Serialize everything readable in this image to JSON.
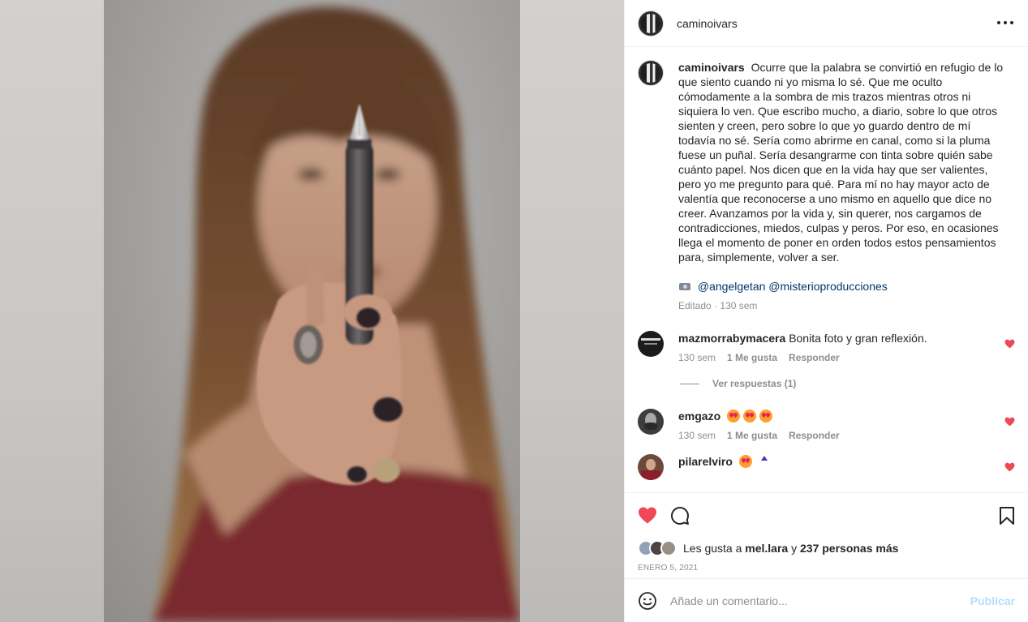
{
  "post": {
    "username": "caminoivars",
    "more_icon": "more-horizontal-icon",
    "caption_text": "Ocurre que la palabra se convirtió en refugio de lo que siento cuando ni yo misma lo sé. Que me oculto cómodamente a la sombra de mis trazos mientras otros ni siquiera lo ven. Que escribo mucho, a diario, sobre lo que otros sienten y creen, pero sobre lo que yo guardo dentro de mí todavía no sé. Sería como abrirme en canal, como si la pluma fuese un puñal. Sería desangrarme con tinta sobre quién sabe cuánto papel. Nos dicen que en la vida hay que ser valientes, pero yo me pregunto para qué. Para mí no hay mayor acto de valentía que reconocerse a uno mismo en aquello que dice no creer. Avanzamos por la vida y, sin querer, nos cargamos de contradicciones, miedos, culpas y peros. Por eso, en ocasiones llega el momento de poner en orden todos estos pensamientos para, simplemente, volver a ser.",
    "credit_icon": "camera-icon",
    "credit_1": "@angelgetan",
    "credit_2": "@misterioproducciones",
    "edited_label": "Editado",
    "edited_separator": "·",
    "edited_age": "130 sem"
  },
  "comments": [
    {
      "username": "mazmorrabymacera",
      "text": "Bonita foto y gran reflexión.",
      "age": "130 sem",
      "likes": "1 Me gusta",
      "reply": "Responder",
      "view_replies": "Ver respuestas (1)"
    },
    {
      "username": "emgazo",
      "text": "",
      "age": "130 sem",
      "likes": "1 Me gusta",
      "reply": "Responder"
    },
    {
      "username": "pilarelviro",
      "text": ""
    }
  ],
  "likes": {
    "prefix": "Les gusta a",
    "user": "mel.lara",
    "connector": "y",
    "others": "237 personas más"
  },
  "date": "ENERO 5, 2021",
  "add_comment": {
    "placeholder": "Añade un comentario...",
    "publish": "Publicar"
  },
  "colors": {
    "liked_heart": "#ed4956",
    "link": "#00376b",
    "secondary_text": "#8e8e8e",
    "publish_disabled": "#b2dffc"
  }
}
